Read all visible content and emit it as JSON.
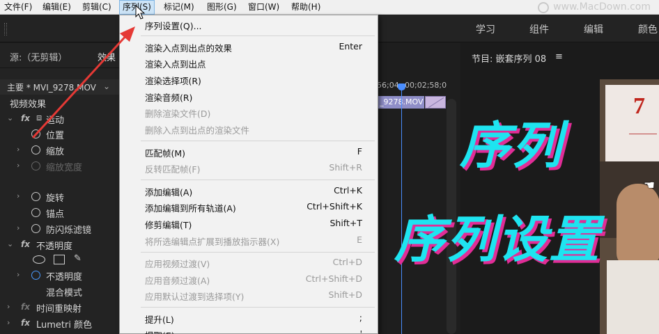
{
  "menubar": {
    "items": [
      "文件(F)",
      "编辑(E)",
      "剪辑(C)",
      "序列(S)",
      "标记(M)",
      "图形(G)",
      "窗口(W)",
      "帮助(H)"
    ],
    "active_index": 3
  },
  "watermark": {
    "text": "www.MacDown.com"
  },
  "workspaces": [
    "学习",
    "组件",
    "编辑",
    "颜色"
  ],
  "source_panel": {
    "source_label": "源:（无剪辑）",
    "effects_tab": "效果",
    "clip_name": "主要 * MVI_9278.MOV",
    "section_title": "视频效果",
    "rows": [
      {
        "label": "运动",
        "fx": true
      },
      {
        "label": "位置"
      },
      {
        "label": "缩放"
      },
      {
        "label": "缩放宽度",
        "disabled": true
      },
      {
        "label": "旋转"
      },
      {
        "label": "锚点"
      },
      {
        "label": "防闪烁滤镜"
      },
      {
        "label": "不透明度",
        "fx": true
      },
      {
        "label": "不透明度"
      },
      {
        "label": "混合模式"
      },
      {
        "label": "时间重映射",
        "fx": true
      },
      {
        "label": "Lumetri 颜色",
        "fx": true
      }
    ]
  },
  "dropdown": {
    "items": [
      {
        "label": "序列设置(Q)...",
        "shortcut": ""
      },
      {
        "label": "渲染入点到出点的效果",
        "shortcut": "Enter"
      },
      {
        "label": "渲染入点到出点",
        "shortcut": ""
      },
      {
        "label": "渲染选择项(R)",
        "shortcut": ""
      },
      {
        "label": "渲染音频(R)",
        "shortcut": ""
      },
      {
        "label": "删除渲染文件(D)",
        "shortcut": "",
        "disabled": true
      },
      {
        "label": "删除入点到出点的渲染文件",
        "shortcut": "",
        "disabled": true
      },
      {
        "label": "匹配帧(M)",
        "shortcut": "F"
      },
      {
        "label": "反转匹配帧(F)",
        "shortcut": "Shift+R",
        "disabled": true
      },
      {
        "label": "添加编辑(A)",
        "shortcut": "Ctrl+K"
      },
      {
        "label": "添加编辑到所有轨道(A)",
        "shortcut": "Ctrl+Shift+K"
      },
      {
        "label": "修剪编辑(T)",
        "shortcut": "Shift+T"
      },
      {
        "label": "将所选编辑点扩展到播放指示器(X)",
        "shortcut": "E",
        "disabled": true
      },
      {
        "label": "应用视频过渡(V)",
        "shortcut": "Ctrl+D",
        "disabled": true
      },
      {
        "label": "应用音频过渡(A)",
        "shortcut": "Ctrl+Shift+D",
        "disabled": true
      },
      {
        "label": "应用默认过渡到选择项(Y)",
        "shortcut": "Shift+D",
        "disabled": true
      },
      {
        "label": "提升(L)",
        "shortcut": ";"
      },
      {
        "label": "提取(E)",
        "shortcut": "'"
      }
    ]
  },
  "timeline": {
    "ruler_left": "56;04",
    "ruler_right": "00;02;58;0",
    "clip_label": "_9278.MOV"
  },
  "program": {
    "title": "节目: 嵌套序列 08",
    "menu_glyph": "≡",
    "poster_text": "7"
  },
  "overlay": {
    "line1": "序列",
    "line2": "序列设置"
  },
  "colors": {
    "overlay_text": "#1ee4f0",
    "overlay_shadow": "#e12d97",
    "arrow": "#e53935",
    "playhead": "#4a8eff"
  }
}
